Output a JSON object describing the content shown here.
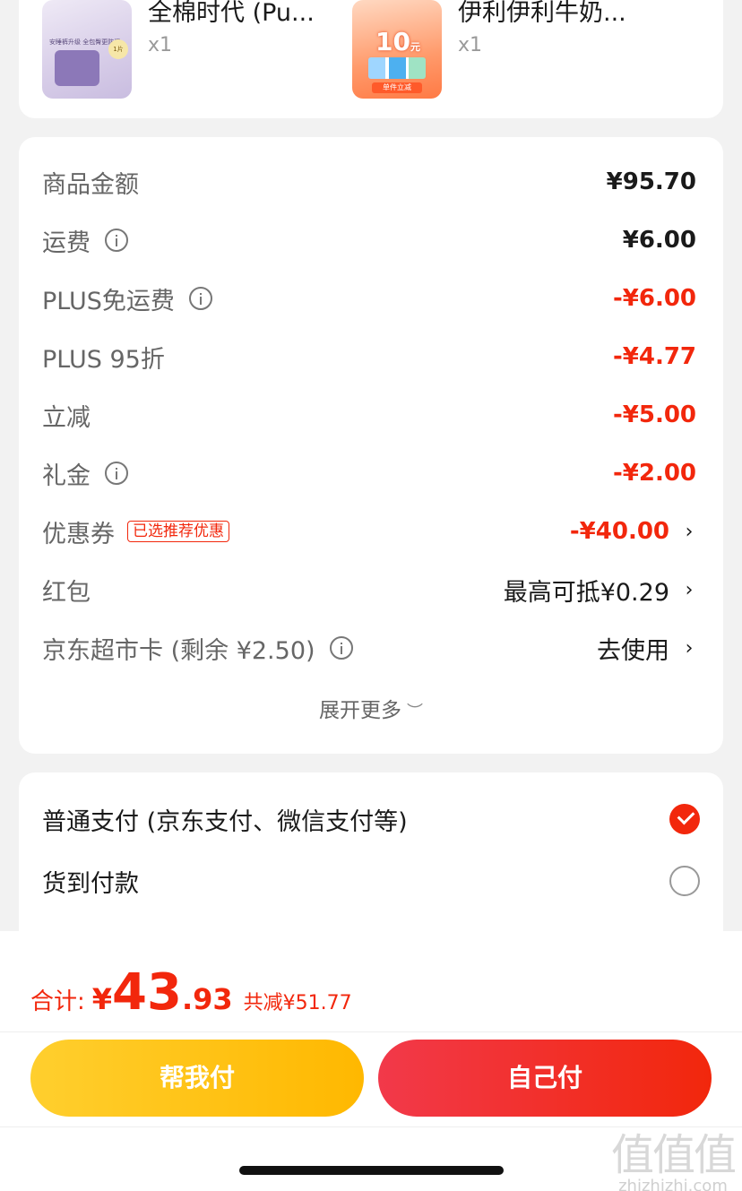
{
  "products": [
    {
      "thumb_text": "安睡裤升级 全包臀更防漏",
      "badge": "1片",
      "name": "全棉时代 (Pu...",
      "qty": "x1"
    },
    {
      "thumb_big": "10",
      "thumb_unit": "元",
      "thumb_strip": "单件立减",
      "name": "伊利伊利牛奶...",
      "qty": "x1"
    }
  ],
  "price_rows": [
    {
      "label": "商品金额",
      "amount": "¥95.70"
    },
    {
      "label": "运费",
      "amount": "¥6.00"
    },
    {
      "label": "PLUS免运费",
      "amount": "-¥6.00"
    },
    {
      "label": "PLUS 95折",
      "amount": "-¥4.77"
    },
    {
      "label": "立减",
      "amount": "-¥5.00"
    },
    {
      "label": "礼金",
      "amount": "-¥2.00"
    },
    {
      "label": "优惠券",
      "tag": "已选推荐优惠",
      "amount": "-¥40.00"
    },
    {
      "label": "红包",
      "amount": "最高可抵¥0.29"
    },
    {
      "label": "京东超市卡 (剩余 ¥2.50)",
      "amount": "去使用"
    }
  ],
  "expand_label": "展开更多",
  "payment": [
    {
      "label": "普通支付 (京东支付、微信支付等)",
      "selected": true
    },
    {
      "label": "货到付款",
      "selected": false
    }
  ],
  "total": {
    "label": "合计:",
    "currency": "¥",
    "integer": "43",
    "decimal": ".93",
    "saved": "共减¥51.77"
  },
  "buttons": {
    "help_pay": "帮我付",
    "self_pay": "自己付"
  },
  "watermark": {
    "big": "值值值",
    "small": "zhizhizhi.com"
  },
  "colors": {
    "accent_red": "#f2270c",
    "help_yellow": "#ffc000",
    "background": "#f2f2f2"
  }
}
